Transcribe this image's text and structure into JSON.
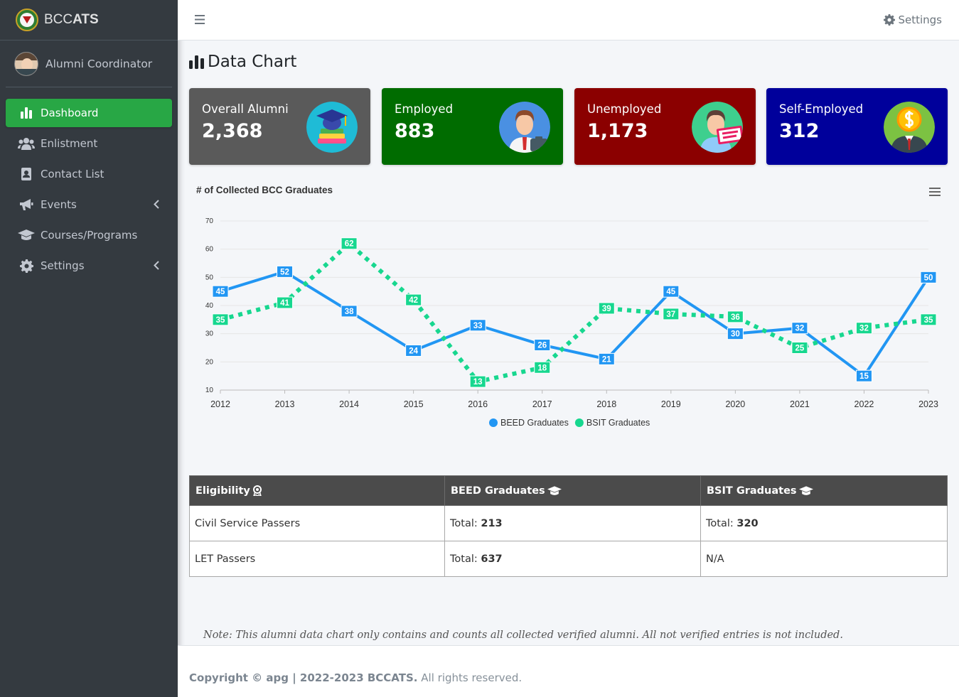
{
  "brand": {
    "name_light": "BCC",
    "name_bold": "ATS"
  },
  "user": {
    "name": "Alumni Coordinator"
  },
  "sidebar": {
    "items": [
      {
        "label": "Dashboard",
        "icon": "chart-bar-icon",
        "active": true
      },
      {
        "label": "Enlistment",
        "icon": "users-icon"
      },
      {
        "label": "Contact List",
        "icon": "address-book-icon"
      },
      {
        "label": "Events",
        "icon": "bullhorn-icon",
        "has_submenu": true
      },
      {
        "label": "Courses/Programs",
        "icon": "graduation-cap-icon"
      },
      {
        "label": "Settings",
        "icon": "gear-icon",
        "has_submenu": true
      }
    ]
  },
  "header": {
    "settings_label": "Settings"
  },
  "page": {
    "title": "Data Chart"
  },
  "cards": [
    {
      "label": "Overall Alumni",
      "value": "2,368",
      "color": "#5a5a5a",
      "icon": "graduation-books-icon"
    },
    {
      "label": "Employed",
      "value": "883",
      "color": "#006c00",
      "icon": "employed-person-icon"
    },
    {
      "label": "Unemployed",
      "value": "1,173",
      "color": "#8b0000",
      "icon": "need-a-job-icon"
    },
    {
      "label": "Self-Employed",
      "value": "312",
      "color": "#00009b",
      "icon": "dollar-head-person-icon"
    }
  ],
  "chart_data": {
    "type": "line",
    "title": "# of Collected BCC Graduates",
    "x": [
      "2012",
      "2013",
      "2014",
      "2015",
      "2016",
      "2017",
      "2018",
      "2019",
      "2020",
      "2021",
      "2022",
      "2023"
    ],
    "ylim": [
      10,
      70
    ],
    "yticks": [
      10,
      20,
      30,
      40,
      50,
      60,
      70
    ],
    "grid": true,
    "legend": "bottom-center",
    "series": [
      {
        "name": "BEED Graduates",
        "color": "#2196f3",
        "dashed": false,
        "values": [
          45,
          52,
          38,
          24,
          33,
          26,
          21,
          45,
          30,
          32,
          15,
          50
        ]
      },
      {
        "name": "BSIT Graduates",
        "color": "#17d78f",
        "dashed": true,
        "values": [
          35,
          41,
          62,
          42,
          13,
          18,
          39,
          37,
          36,
          25,
          32,
          35
        ]
      }
    ]
  },
  "table": {
    "headers": [
      "Eligibility",
      "BEED Graduates",
      "BSIT Graduates"
    ],
    "total_label": "Total:",
    "rows": [
      {
        "name": "Civil Service Passers",
        "beed": "213",
        "bsit": "320"
      },
      {
        "name": "LET Passers",
        "beed": "637",
        "bsit": "N/A"
      }
    ]
  },
  "note": "Note: This alumni data chart only contains and counts all collected verified alumni. All not verified entries is not included.",
  "footer": {
    "copyright": "Copyright © apg | 2022-2023 BCCATS.",
    "rights": "All rights reserved."
  }
}
